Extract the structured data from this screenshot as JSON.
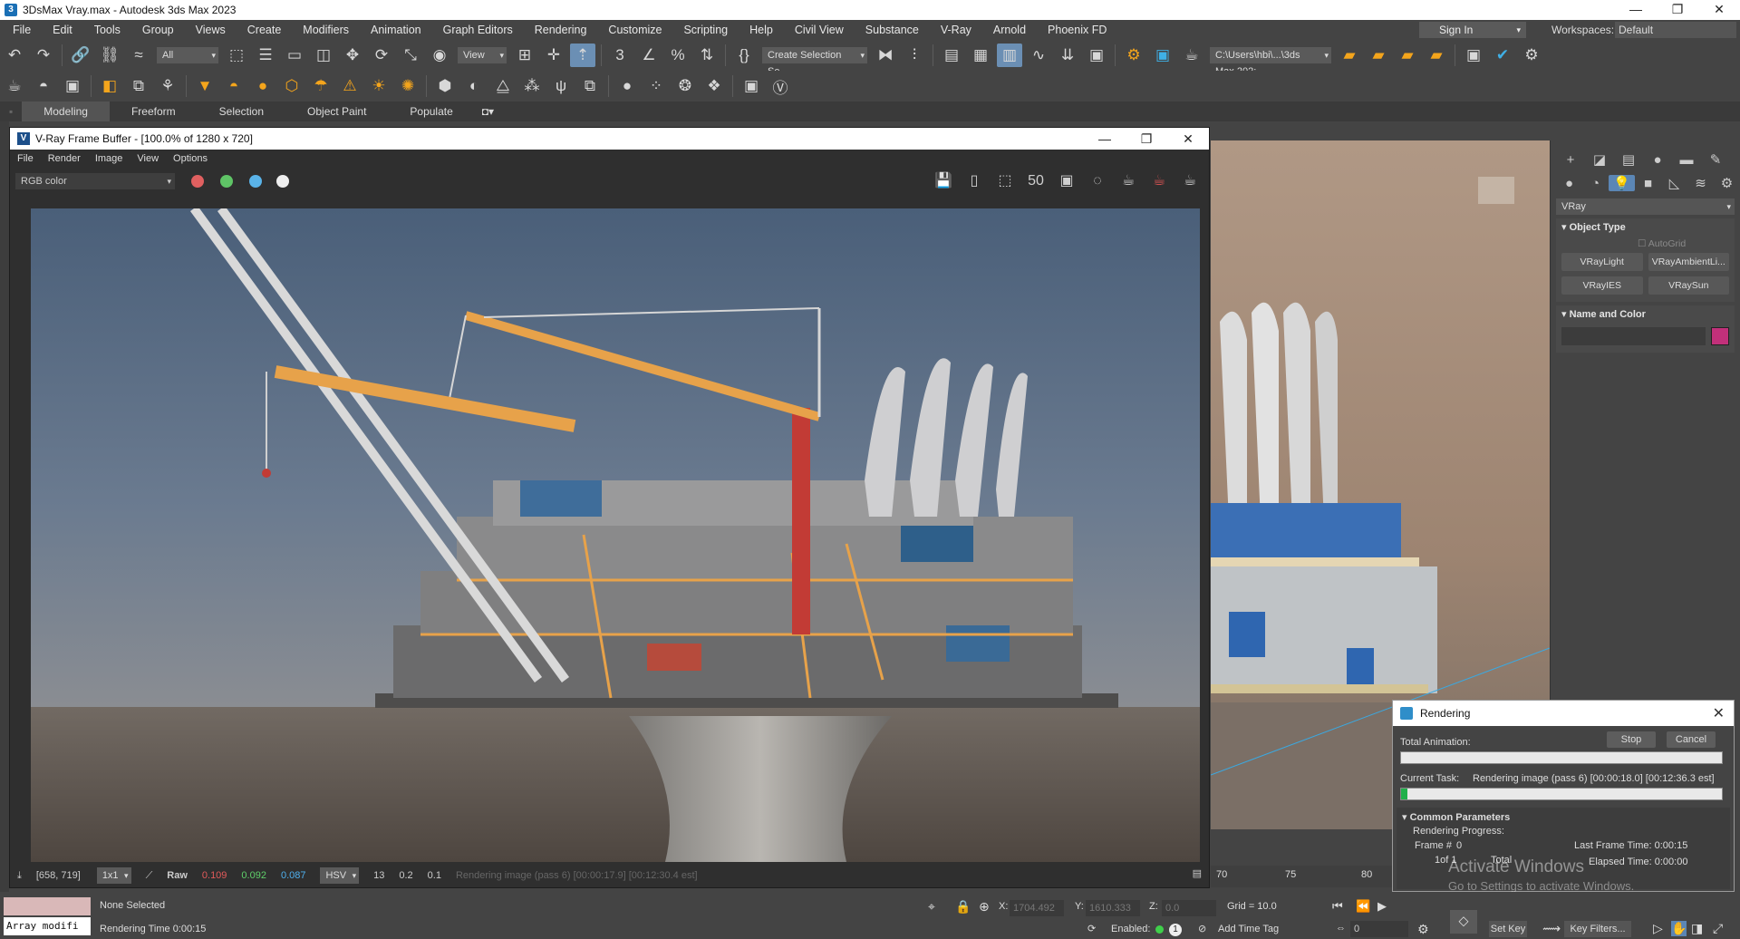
{
  "window": {
    "title": "3DsMax Vray.max - Autodesk 3ds Max 2023",
    "controls": [
      "—",
      "❐",
      "✕"
    ]
  },
  "menu": [
    "File",
    "Edit",
    "Tools",
    "Group",
    "Views",
    "Create",
    "Modifiers",
    "Animation",
    "Graph Editors",
    "Rendering",
    "Customize",
    "Scripting",
    "Help",
    "Civil View",
    "Substance",
    "V-Ray",
    "Arnold",
    "Phoenix FD"
  ],
  "signin": "Sign In",
  "workspaces": {
    "label": "Workspaces:",
    "value": "Default"
  },
  "toolbar": {
    "selection_filter": "All",
    "ref_coord": "View",
    "named_selection": "Create Selection Se",
    "project_path": "C:\\Users\\hbi\\...\\3ds Max 202:"
  },
  "ribbon_tabs": [
    "Modeling",
    "Freeform",
    "Selection",
    "Object Paint",
    "Populate"
  ],
  "command_panel": {
    "renderer_select": "VRay",
    "object_type": {
      "title": "Object Type",
      "autogrid": "AutoGrid",
      "buttons": [
        "VRayLight",
        "VRayAmbientLi...",
        "VRayIES",
        "VRaySun"
      ]
    },
    "name_color": {
      "title": "Name and Color",
      "color": "#c2307a"
    }
  },
  "vfb": {
    "title": "V-Ray Frame Buffer - [100.0% of 1280 x 720]",
    "menu": [
      "File",
      "Render",
      "Image",
      "View",
      "Options"
    ],
    "channel": "RGB color",
    "status": {
      "coords": "[658, 719]",
      "zoom": "1x1",
      "raw": "Raw",
      "r": "0.109",
      "g": "0.092",
      "b": "0.087",
      "mode": "HSV",
      "h": "13",
      "s": "0.2",
      "v": "0.1",
      "message": "Rendering image (pass 6) [00:00:17.9] [00:12:30.4 est]"
    }
  },
  "render_dialog": {
    "title": "Rendering",
    "stop": "Stop",
    "cancel": "Cancel",
    "total_animation": "Total Animation:",
    "current_task_label": "Current Task:",
    "current_task": "Rendering image (pass 6) [00:00:18.0] [00:12:36.3 est]",
    "total_progress": 0,
    "task_progress": 0.02,
    "common_params": "Common Parameters",
    "rendering_progress": "Rendering Progress:",
    "frame_label": "Frame #",
    "frame_value": "0",
    "of": "1of 1",
    "total": "Total",
    "last_frame_time": "Last Frame Time:  0:00:15",
    "elapsed_time": "Elapsed Time:  0:00:00"
  },
  "watermark": {
    "line1": "Activate Windows",
    "line2": "Go to Settings to activate Windows."
  },
  "timeline": {
    "ticks": [
      "70",
      "75",
      "80"
    ]
  },
  "statusbar": {
    "maxscript": "Array modifi",
    "selection": "None Selected",
    "render_time": "Rendering Time  0:00:15",
    "x_label": "X:",
    "x": "1704.492",
    "y_label": "Y:",
    "y": "1610.333",
    "z_label": "Z:",
    "z": "0.0",
    "grid": "Grid = 10.0",
    "enabled": "Enabled:",
    "add_time_tag": "Add Time Tag",
    "set_key": "Set Key",
    "key_filters": "Key Filters...",
    "frame": "0"
  }
}
